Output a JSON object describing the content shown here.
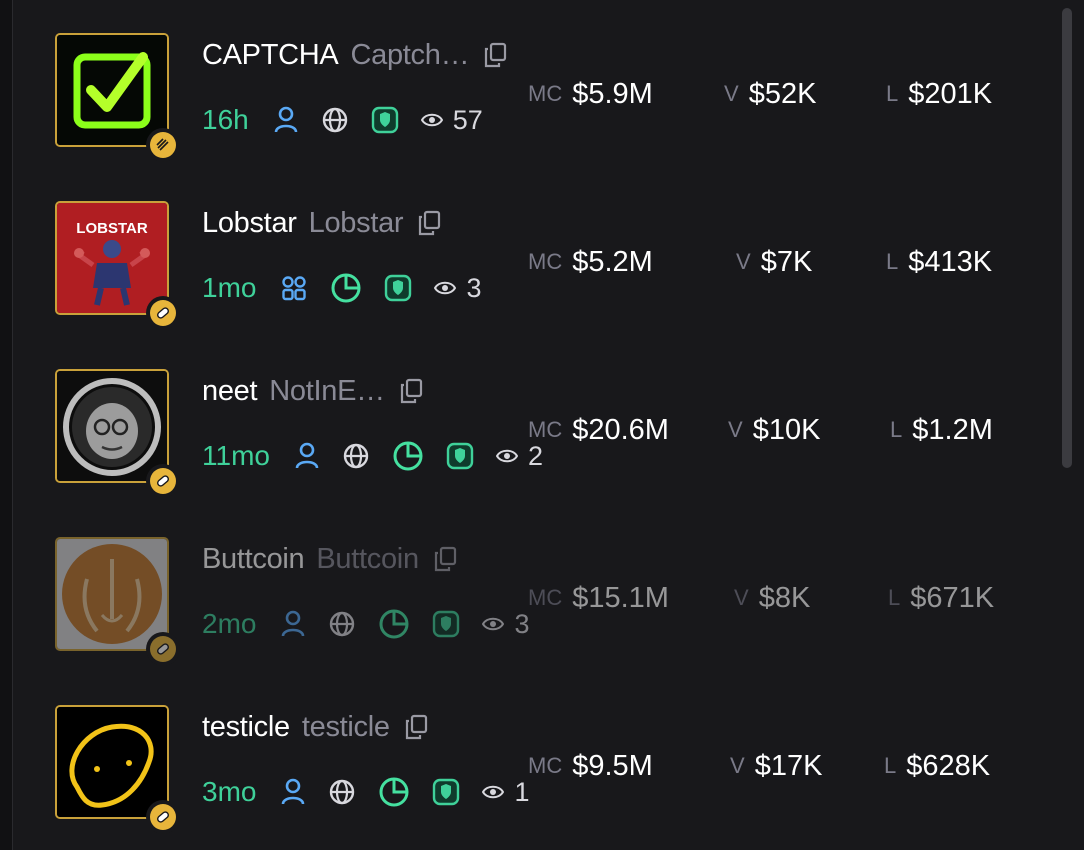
{
  "tokens": [
    {
      "ticker": "CAPTCHA",
      "name": "Captch…",
      "age": "16h",
      "views": "57",
      "mc_label": "MC",
      "mc": "$5.9M",
      "v_label": "V",
      "volume": "$52K",
      "l_label": "L",
      "liquidity": "$201K",
      "avatar": "captcha-checkbox",
      "badge": "striped-icon",
      "meta_icons": [
        "user-icon",
        "globe-icon",
        "shield-icon"
      ]
    },
    {
      "ticker": "Lobstar",
      "name": "Lobstar",
      "age": "1mo",
      "views": "3",
      "mc_label": "MC",
      "mc": "$5.2M",
      "v_label": "V",
      "volume": "$7K",
      "l_label": "L",
      "liquidity": "$413K",
      "avatar": "lobstar-poster",
      "avatar_text": "LOBSTAR",
      "badge": "pill-icon",
      "meta_icons": [
        "grid-icon",
        "pie-icon",
        "shield-icon"
      ]
    },
    {
      "ticker": "neet",
      "name": "NotInE…",
      "age": "11mo",
      "views": "2",
      "mc_label": "MC",
      "mc": "$20.6M",
      "v_label": "V",
      "volume": "$10K",
      "l_label": "L",
      "liquidity": "$1.2M",
      "avatar": "neet-face",
      "badge": "pill-icon",
      "meta_icons": [
        "user-icon",
        "globe-icon",
        "pie-icon",
        "shield-icon"
      ]
    },
    {
      "ticker": "Buttcoin",
      "name": "Buttcoin",
      "age": "2mo",
      "views": "3",
      "mc_label": "MC",
      "mc": "$15.1M",
      "v_label": "V",
      "volume": "$8K",
      "l_label": "L",
      "liquidity": "$671K",
      "avatar": "buttcoin-logo",
      "badge": "pill-icon",
      "meta_icons": [
        "user-icon",
        "globe-icon",
        "pie-icon",
        "shield-icon"
      ]
    },
    {
      "ticker": "testicle",
      "name": "testicle",
      "age": "3mo",
      "views": "1",
      "mc_label": "MC",
      "mc": "$9.5M",
      "v_label": "V",
      "volume": "$17K",
      "l_label": "L",
      "liquidity": "$628K",
      "avatar": "testicle-doodle",
      "badge": "pill-icon",
      "meta_icons": [
        "user-icon",
        "globe-icon",
        "pie-icon",
        "shield-icon"
      ]
    }
  ],
  "colors": {
    "background": "#18181b",
    "age": "#3fd19a",
    "ticker": "#ffffff",
    "name": "#8a8a96",
    "user_icon": "#5aa9f5",
    "pie_icon": "#45e0a0",
    "shield_icon": "#3fd19a",
    "avatar_border": "#c9a13a",
    "badge": "#e7b53b"
  }
}
